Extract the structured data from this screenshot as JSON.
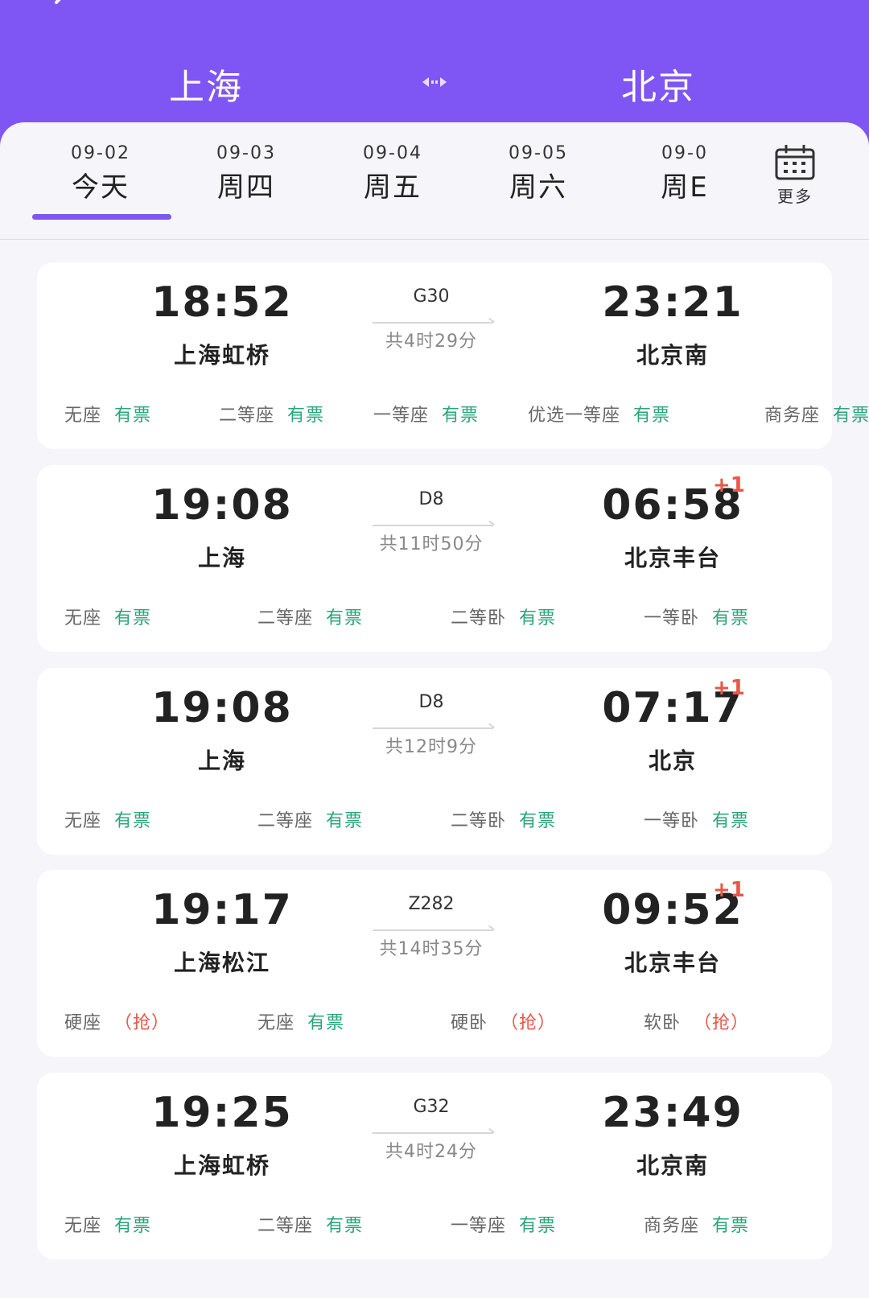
{
  "header": {
    "from_city": "上海",
    "to_city": "北京",
    "icons": {
      "back": "back-arrow-icon",
      "swap": "swap-arrows-icon"
    },
    "colors": {
      "primary": "#7f55f3",
      "available": "#2aa57a",
      "grab": "#e8584a"
    }
  },
  "dates": {
    "tabs": [
      {
        "date": "09-02",
        "weekday": "今天",
        "selected": true
      },
      {
        "date": "09-03",
        "weekday": "周四",
        "selected": false
      },
      {
        "date": "09-04",
        "weekday": "周五",
        "selected": false
      },
      {
        "date": "09-05",
        "weekday": "周六",
        "selected": false
      },
      {
        "date": "09-0",
        "weekday": "周E",
        "selected": false
      }
    ],
    "more_label": "更多",
    "more_icon": "calendar-icon"
  },
  "trains": [
    {
      "dep_time": "18:52",
      "dep_station": "上海虹桥",
      "train_no": "G30",
      "duration": "共4时29分",
      "arr_time": "23:21",
      "arr_station": "北京南",
      "next_day": "",
      "seats": [
        {
          "name": "无座",
          "status": "有票",
          "type": "ok"
        },
        {
          "name": "二等座",
          "status": "有票",
          "type": "ok"
        },
        {
          "name": "一等座",
          "status": "有票",
          "type": "ok"
        },
        {
          "name": "优选一等座",
          "status": "有票",
          "type": "ok"
        },
        {
          "name": "商务座",
          "status": "有票",
          "type": "ok"
        }
      ]
    },
    {
      "dep_time": "19:08",
      "dep_station": "上海",
      "train_no": "D8",
      "duration": "共11时50分",
      "arr_time": "06:58",
      "arr_station": "北京丰台",
      "next_day": "+1",
      "seats": [
        {
          "name": "无座",
          "status": "有票",
          "type": "ok"
        },
        {
          "name": "二等座",
          "status": "有票",
          "type": "ok"
        },
        {
          "name": "二等卧",
          "status": "有票",
          "type": "ok"
        },
        {
          "name": "一等卧",
          "status": "有票",
          "type": "ok"
        }
      ]
    },
    {
      "dep_time": "19:08",
      "dep_station": "上海",
      "train_no": "D8",
      "duration": "共12时9分",
      "arr_time": "07:17",
      "arr_station": "北京",
      "next_day": "+1",
      "seats": [
        {
          "name": "无座",
          "status": "有票",
          "type": "ok"
        },
        {
          "name": "二等座",
          "status": "有票",
          "type": "ok"
        },
        {
          "name": "二等卧",
          "status": "有票",
          "type": "ok"
        },
        {
          "name": "一等卧",
          "status": "有票",
          "type": "ok"
        }
      ]
    },
    {
      "dep_time": "19:17",
      "dep_station": "上海松江",
      "train_no": "Z282",
      "duration": "共14时35分",
      "arr_time": "09:52",
      "arr_station": "北京丰台",
      "next_day": "+1",
      "seats": [
        {
          "name": "硬座",
          "status": "（抢）",
          "type": "grab"
        },
        {
          "name": "无座",
          "status": "有票",
          "type": "ok"
        },
        {
          "name": "硬卧",
          "status": "（抢）",
          "type": "grab"
        },
        {
          "name": "软卧",
          "status": "（抢）",
          "type": "grab"
        }
      ]
    },
    {
      "dep_time": "19:25",
      "dep_station": "上海虹桥",
      "train_no": "G32",
      "duration": "共4时24分",
      "arr_time": "23:49",
      "arr_station": "北京南",
      "next_day": "",
      "seats": [
        {
          "name": "无座",
          "status": "有票",
          "type": "ok"
        },
        {
          "name": "二等座",
          "status": "有票",
          "type": "ok"
        },
        {
          "name": "一等座",
          "status": "有票",
          "type": "ok"
        },
        {
          "name": "商务座",
          "status": "有票",
          "type": "ok"
        }
      ]
    }
  ]
}
